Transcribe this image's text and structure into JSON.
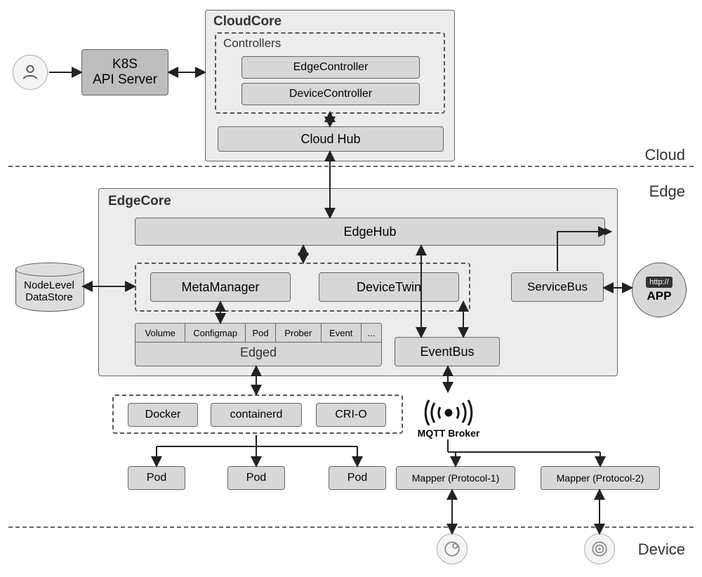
{
  "zones": {
    "cloud": "Cloud",
    "edge": "Edge",
    "device": "Device"
  },
  "user": {
    "label": ""
  },
  "k8s": {
    "label": "K8S\nAPI Server"
  },
  "cloudcore": {
    "title": "CloudCore",
    "controllers": {
      "title": "Controllers",
      "edge": "EdgeController",
      "device": "DeviceController"
    },
    "cloudhub": "Cloud Hub"
  },
  "edgecore": {
    "title": "EdgeCore",
    "edgehub": "EdgeHub",
    "metamanager": "MetaManager",
    "devicetwin": "DeviceTwin",
    "servicebus": "ServiceBus",
    "edged": {
      "title": "Edged",
      "tabs": [
        "Volume",
        "Configmap",
        "Pod",
        "Prober",
        "Event",
        "..."
      ]
    },
    "eventbus": "EventBus"
  },
  "nodeleveldatastore": "NodeLevel\nDataStore",
  "httpapp": {
    "badge": "http://",
    "label": "APP"
  },
  "runtimes": {
    "docker": "Docker",
    "containerd": "containerd",
    "crio": "CRI-O"
  },
  "pods": {
    "p1": "Pod",
    "p2": "Pod",
    "p3": "Pod"
  },
  "mqtt": "MQTT Broker",
  "mappers": {
    "m1": "Mapper (Protocol-1)",
    "m2": "Mapper (Protocol-2)"
  }
}
